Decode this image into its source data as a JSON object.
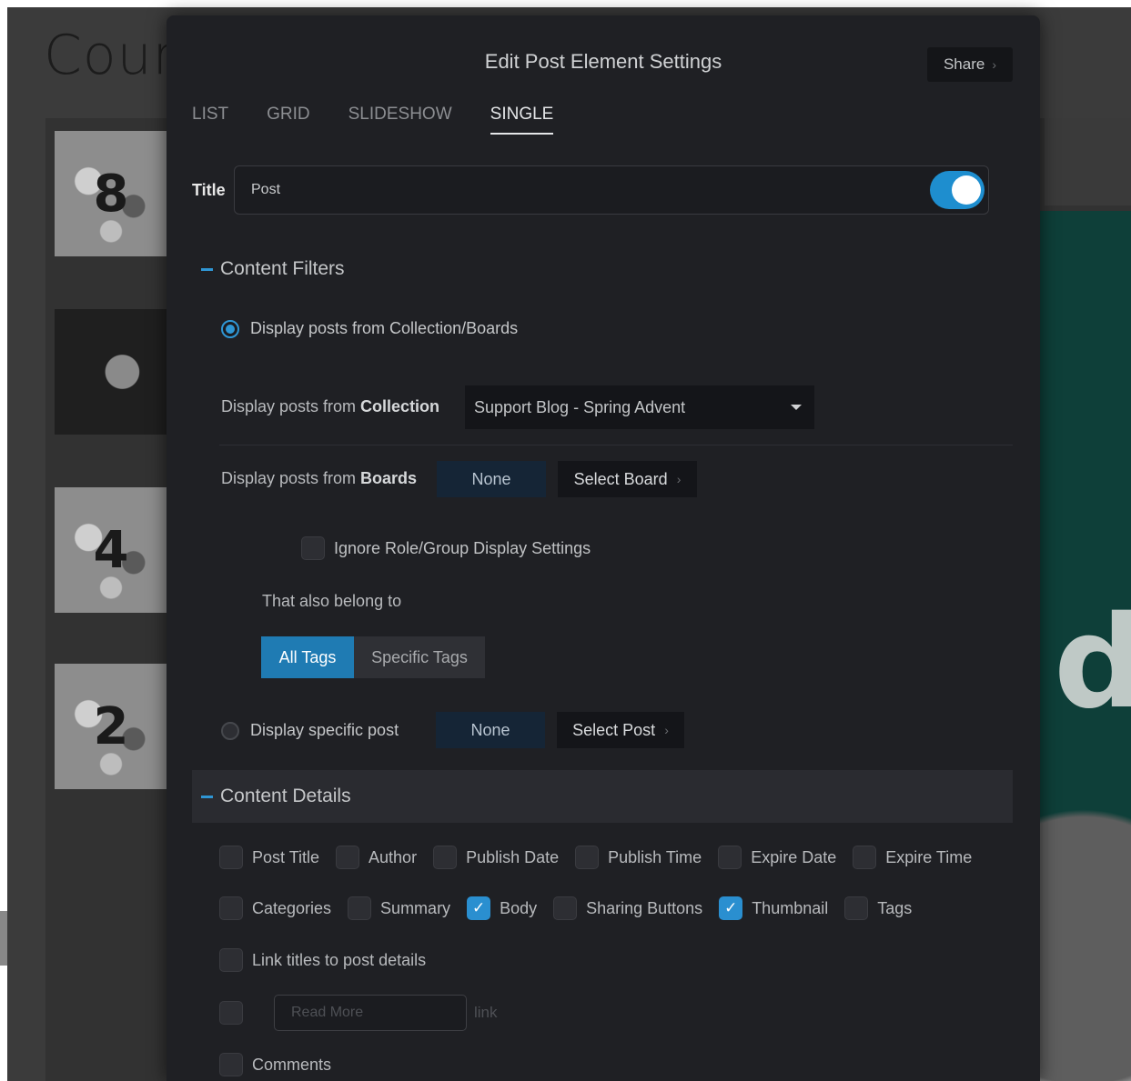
{
  "background": {
    "heading": "Coun",
    "thumb_numbers": [
      "8",
      "",
      "4",
      "2"
    ],
    "right_letter": "d"
  },
  "modal": {
    "title": "Edit Post Element Settings",
    "share_label": "Share",
    "chevron": "›",
    "tabs": [
      "LIST",
      "GRID",
      "SLIDESHOW",
      "SINGLE"
    ],
    "active_tab": "SINGLE",
    "title_field": {
      "label": "Title",
      "value": "Post",
      "toggle_on": true
    }
  },
  "content_filters": {
    "heading": "Content Filters",
    "option_collection_boards": "Display posts from Collection/Boards",
    "collection": {
      "prefix": "Display posts from ",
      "bold": "Collection",
      "selected": "Support Blog - Spring Advent"
    },
    "boards": {
      "prefix": "Display posts from ",
      "bold": "Boards",
      "value": "None",
      "button": "Select Board"
    },
    "ignore_label": "Ignore Role/Group Display Settings",
    "ignore_checked": false,
    "also_belong": "That also belong to",
    "tags_options": [
      "All Tags",
      "Specific Tags"
    ],
    "tags_selected": "All Tags",
    "option_specific_post": "Display specific post",
    "specific_post": {
      "value": "None",
      "button": "Select Post"
    },
    "selected_option": "collection_boards"
  },
  "content_details": {
    "heading": "Content Details",
    "row1": [
      {
        "label": "Post Title",
        "checked": false
      },
      {
        "label": "Author",
        "checked": false
      },
      {
        "label": "Publish Date",
        "checked": false
      },
      {
        "label": "Publish Time",
        "checked": false
      },
      {
        "label": "Expire Date",
        "checked": false
      },
      {
        "label": "Expire Time",
        "checked": false
      }
    ],
    "row2": [
      {
        "label": "Categories",
        "checked": false
      },
      {
        "label": "Summary",
        "checked": false
      },
      {
        "label": "Body",
        "checked": true
      },
      {
        "label": "Sharing Buttons",
        "checked": false
      },
      {
        "label": "Thumbnail",
        "checked": true
      },
      {
        "label": "Tags",
        "checked": false
      }
    ],
    "link_titles": {
      "label": "Link titles to post details",
      "checked": false
    },
    "read_more": {
      "placeholder": "Read More",
      "suffix": "link",
      "checked": false
    },
    "comments": {
      "label": "Comments",
      "checked": false
    }
  },
  "colors": {
    "accent": "#2f96d4",
    "modal_bg": "#1f2024",
    "checkbox_on": "#2a8fd0"
  }
}
